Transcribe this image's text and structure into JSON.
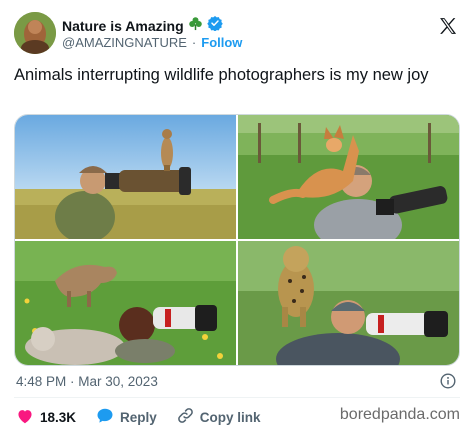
{
  "author": {
    "display_name": "Nature is Amazing",
    "emoji": "☘️",
    "handle": "@AMAZINGNATURE",
    "separator": "·",
    "follow_label": "Follow"
  },
  "tweet": {
    "text": "Animals interrupting wildlife photographers is my new joy"
  },
  "media": {
    "photos": [
      {
        "subject": "meerkat-on-lens"
      },
      {
        "subject": "fox-on-shoulder"
      },
      {
        "subject": "kangaroo-on-photographer"
      },
      {
        "subject": "cheetah-cub-on-shoulder"
      }
    ]
  },
  "meta": {
    "timestamp": "4:48 PM · Mar 30, 2023"
  },
  "actions": {
    "likes": "18.3K",
    "reply_label": "Reply",
    "copy_label": "Copy link"
  },
  "watermark": "boredpanda.com",
  "colors": {
    "accent": "#1d9bf0",
    "like": "#f91880",
    "text": "#0f1419",
    "muted": "#536471"
  },
  "icons": [
    "x-logo-icon",
    "verified-badge-icon",
    "shamrock-emoji",
    "info-icon",
    "heart-icon",
    "reply-bubble-icon",
    "link-icon"
  ]
}
